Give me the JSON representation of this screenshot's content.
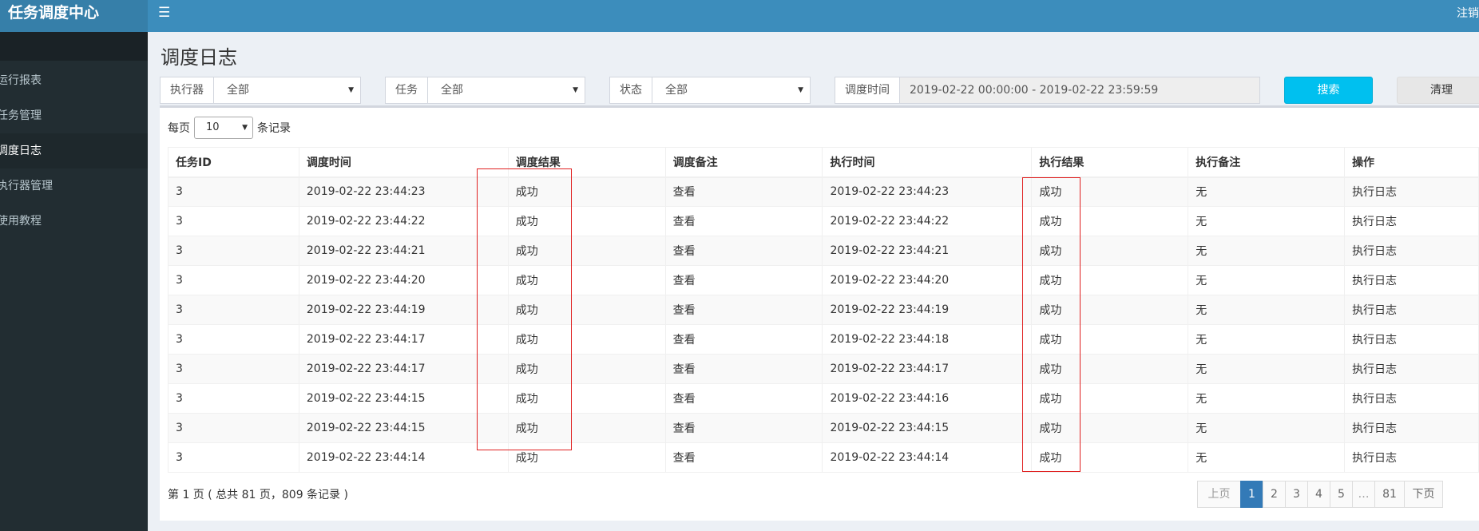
{
  "app": {
    "title": "任务调度中心",
    "logout": "注销"
  },
  "sidebar": {
    "items": [
      {
        "label": "运行报表"
      },
      {
        "label": "任务管理"
      },
      {
        "label": "调度日志",
        "active": true
      },
      {
        "label": "执行器管理"
      },
      {
        "label": "使用教程"
      }
    ]
  },
  "page": {
    "title": "调度日志"
  },
  "filters": {
    "executor": {
      "label": "执行器",
      "value": "全部"
    },
    "job": {
      "label": "任务",
      "value": "全部"
    },
    "status": {
      "label": "状态",
      "value": "全部"
    },
    "time": {
      "label": "调度时间",
      "value": "2019-02-22 00:00:00 - 2019-02-22 23:59:59"
    },
    "search_label": "搜索",
    "clear_label": "清理"
  },
  "length": {
    "prefix": "每页",
    "value": "10",
    "suffix": "条记录"
  },
  "table": {
    "headers": [
      "任务ID",
      "调度时间",
      "调度结果",
      "调度备注",
      "执行时间",
      "执行结果",
      "执行备注",
      "操作"
    ],
    "rows": [
      [
        "3",
        "2019-02-22 23:44:23",
        "成功",
        "查看",
        "2019-02-22 23:44:23",
        "成功",
        "无",
        "执行日志"
      ],
      [
        "3",
        "2019-02-22 23:44:22",
        "成功",
        "查看",
        "2019-02-22 23:44:22",
        "成功",
        "无",
        "执行日志"
      ],
      [
        "3",
        "2019-02-22 23:44:21",
        "成功",
        "查看",
        "2019-02-22 23:44:21",
        "成功",
        "无",
        "执行日志"
      ],
      [
        "3",
        "2019-02-22 23:44:20",
        "成功",
        "查看",
        "2019-02-22 23:44:20",
        "成功",
        "无",
        "执行日志"
      ],
      [
        "3",
        "2019-02-22 23:44:19",
        "成功",
        "查看",
        "2019-02-22 23:44:19",
        "成功",
        "无",
        "执行日志"
      ],
      [
        "3",
        "2019-02-22 23:44:17",
        "成功",
        "查看",
        "2019-02-22 23:44:18",
        "成功",
        "无",
        "执行日志"
      ],
      [
        "3",
        "2019-02-22 23:44:17",
        "成功",
        "查看",
        "2019-02-22 23:44:17",
        "成功",
        "无",
        "执行日志"
      ],
      [
        "3",
        "2019-02-22 23:44:15",
        "成功",
        "查看",
        "2019-02-22 23:44:16",
        "成功",
        "无",
        "执行日志"
      ],
      [
        "3",
        "2019-02-22 23:44:15",
        "成功",
        "查看",
        "2019-02-22 23:44:15",
        "成功",
        "无",
        "执行日志"
      ],
      [
        "3",
        "2019-02-22 23:44:14",
        "成功",
        "查看",
        "2019-02-22 23:44:14",
        "成功",
        "无",
        "执行日志"
      ]
    ]
  },
  "pagination": {
    "info": "第 1 页 ( 总共 81 页，809 条记录 )",
    "prev": "上页",
    "pages": [
      "1",
      "2",
      "3",
      "4",
      "5",
      "…",
      "81"
    ],
    "next": "下页"
  },
  "colors": {
    "header": "#3c8dbc",
    "sidebar": "#222d32",
    "success": "#00a65a",
    "link": "#3c8dbc",
    "search_button": "#00c0ef",
    "annotation": "#e02020"
  },
  "icons": {
    "menu_toggle": "hamburger-icon"
  }
}
